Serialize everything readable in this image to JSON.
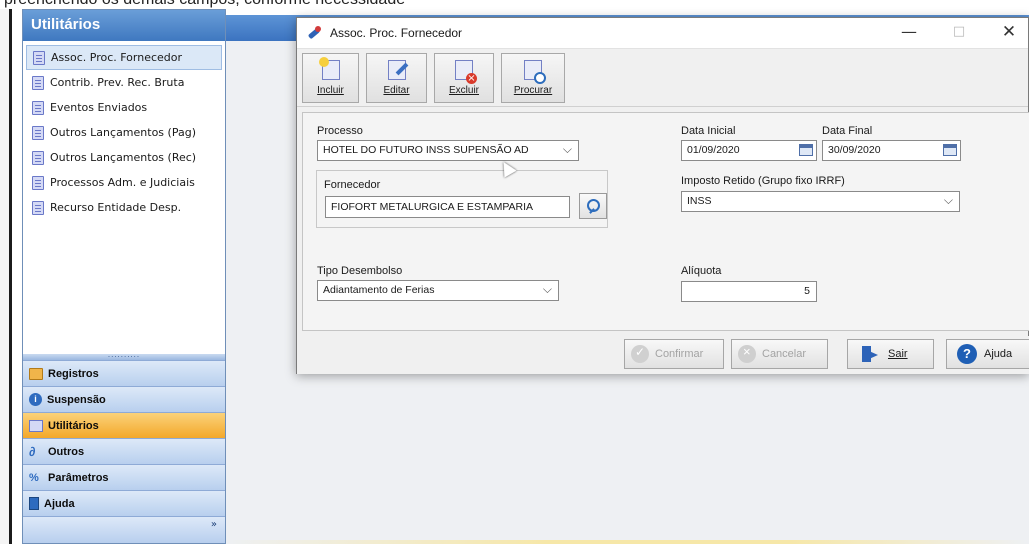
{
  "caption": "preenchendo os demais campos, conforme necessidade",
  "sidebar": {
    "title": "Utilitários",
    "items": [
      {
        "label": "Assoc. Proc. Fornecedor",
        "selected": true
      },
      {
        "label": "Contrib. Prev. Rec. Bruta"
      },
      {
        "label": "Eventos Enviados"
      },
      {
        "label": "Outros Lançamentos (Pag)"
      },
      {
        "label": "Outros Lançamentos (Rec)"
      },
      {
        "label": "Processos Adm. e Judiciais"
      },
      {
        "label": "Recurso Entidade Desp."
      }
    ],
    "nav": [
      {
        "label": "Registros",
        "icon": "folder-icon"
      },
      {
        "label": "Suspensão",
        "icon": "info-icon"
      },
      {
        "label": "Utilitários",
        "icon": "document-icon",
        "active": true
      },
      {
        "label": "Outros",
        "icon": "link-icon"
      },
      {
        "label": "Parâmetros",
        "icon": "parameters-icon"
      },
      {
        "label": "Ajuda",
        "icon": "help-book-icon"
      }
    ],
    "splitter_dots": "..........",
    "expand_glyph": "»"
  },
  "dialog": {
    "title": "Assoc. Proc. Fornecedor",
    "controls": {
      "minimize": "—",
      "maximize": "□",
      "close": "✕"
    },
    "toolbar": {
      "incluir": "Incluir",
      "editar": "Editar",
      "excluir": "Excluir",
      "procurar": "Procurar"
    },
    "form": {
      "processo_label": "Processo",
      "processo_value": "HOTEL DO FUTURO INSS SUPENSÃO AD",
      "fornecedor_label": "Fornecedor",
      "fornecedor_value": "FIOFORT METALURGICA E ESTAMPARIA",
      "tipo_label": "Tipo Desembolso",
      "tipo_value": "Adiantamento de Ferias",
      "data_inicial_label": "Data Inicial",
      "data_inicial_value": "01/09/2020",
      "data_final_label": "Data Final",
      "data_final_value": "30/09/2020",
      "imposto_label": "Imposto Retido (Grupo fixo IRRF)",
      "imposto_value": "INSS",
      "aliquota_label": "Alíquota",
      "aliquota_value": "5"
    },
    "footer": {
      "confirmar": "Confirmar",
      "cancelar": "Cancelar",
      "sair": "Sair",
      "ajuda": "Ajuda"
    }
  },
  "colors": {
    "sidebar_header": "#3f78c0",
    "active_nav": "#f3a82a",
    "app_bar": "#3b73c0",
    "dialog_bg": "#f0f0f0"
  }
}
